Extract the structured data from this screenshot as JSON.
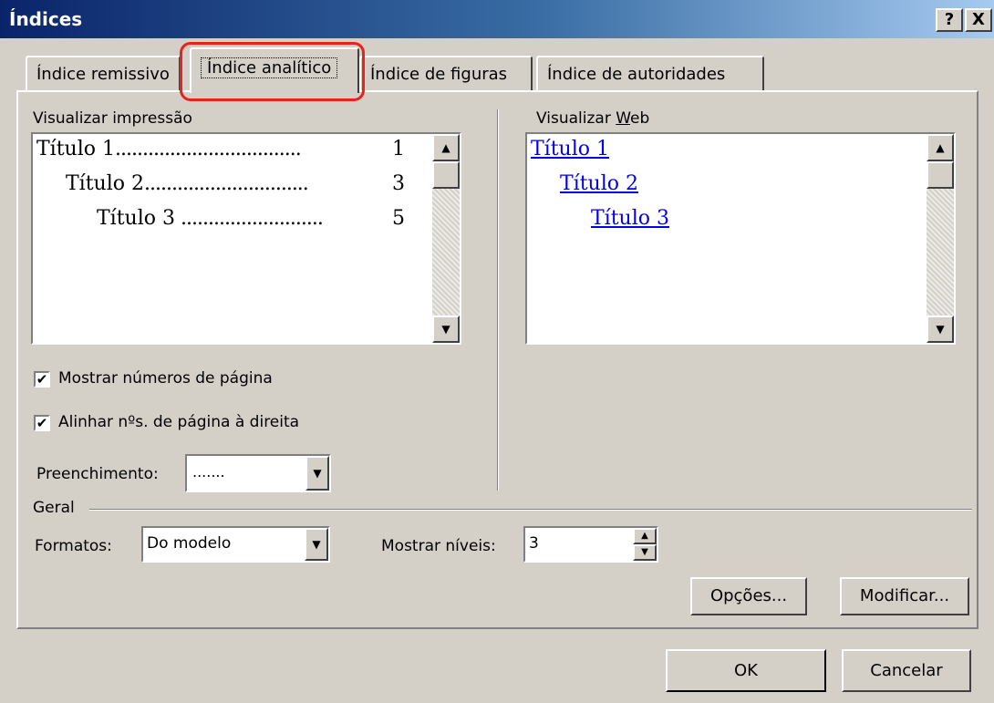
{
  "window": {
    "title": "Índices",
    "help_glyph": "?",
    "close_glyph": "X"
  },
  "tabs": [
    {
      "label": "Índice remissivo"
    },
    {
      "label": "Índice analítico"
    },
    {
      "label": "Índice de figuras"
    },
    {
      "label": "Índice de autoridades"
    }
  ],
  "print_preview": {
    "label": "Visualizar impressão",
    "entries": [
      {
        "text": "Título 1",
        "dots": "..................................",
        "page": "1"
      },
      {
        "text": "Título 2",
        "dots": "..............................",
        "page": "3"
      },
      {
        "text": "Título 3",
        "dots": " ..........................",
        "page": "5"
      }
    ]
  },
  "web_preview": {
    "label": "Visualizar Web",
    "links": [
      "Título 1",
      "Título 2",
      "Título 3"
    ]
  },
  "options": {
    "show_page_numbers": {
      "label": "Mostrar números de página",
      "checked": true
    },
    "align_page_numbers": {
      "label": "Alinhar nºs. de página à direita",
      "checked": true
    },
    "fill": {
      "label": "Preenchimento:",
      "value": "......."
    }
  },
  "general": {
    "label": "Geral",
    "formats": {
      "label": "Formatos:",
      "value": "Do modelo"
    },
    "levels": {
      "label": "Mostrar níveis:",
      "value": "3"
    }
  },
  "buttons": {
    "options": "Opções...",
    "modify": "Modificar...",
    "ok": "OK",
    "cancel": "Cancelar"
  },
  "icons": {
    "check": "✔",
    "up": "▲",
    "down": "▼"
  }
}
